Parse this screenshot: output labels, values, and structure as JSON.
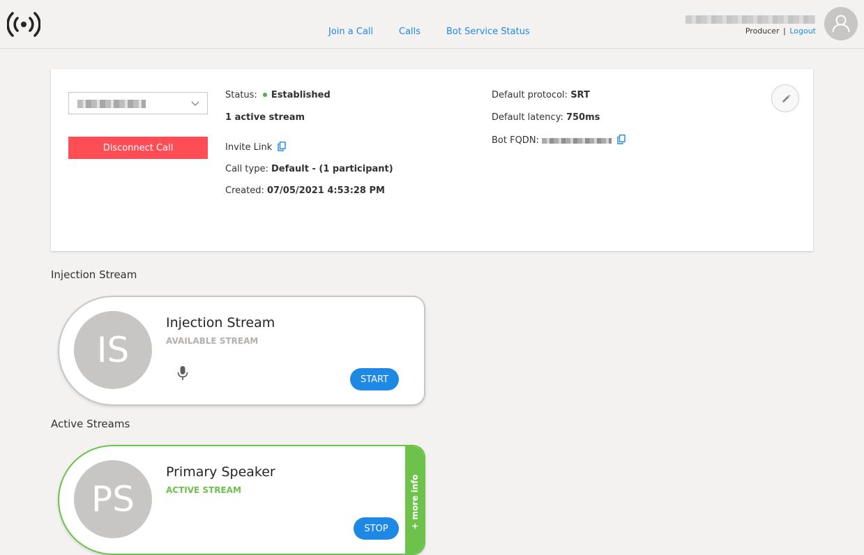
{
  "header": {
    "nav": [
      {
        "label": "Join a Call"
      },
      {
        "label": "Calls"
      },
      {
        "label": "Bot Service Status"
      }
    ],
    "user": {
      "role": "Producer",
      "separator": "|",
      "logout_label": "Logout"
    }
  },
  "call": {
    "disconnect_label": "Disconnect Call",
    "status_label": "Status:",
    "status_value": "Established",
    "active_streams": "1 active stream",
    "invite_label": "Invite Link",
    "call_type_label": "Call type:",
    "call_type_value": "Default - (1 participant)",
    "created_label": "Created:",
    "created_value": "07/05/2021 4:53:28 PM",
    "protocol_label": "Default protocol:",
    "protocol_value": "SRT",
    "latency_label": "Default latency:",
    "latency_value": "750ms",
    "fqdn_label": "Bot FQDN:"
  },
  "injection": {
    "section_title": "Injection Stream",
    "card": {
      "initials": "IS",
      "name": "Injection Stream",
      "state": "AVAILABLE STREAM",
      "button_label": "START"
    }
  },
  "active": {
    "section_title": "Active Streams",
    "card": {
      "initials": "PS",
      "name": "Primary Speaker",
      "state": "ACTIVE STREAM",
      "button_label": "STOP",
      "more_info_label": "+ more info"
    }
  },
  "colors": {
    "link": "#1e88e5",
    "danger": "#ff4d56",
    "active": "#6cc24a",
    "status_ok": "#4caf50",
    "background": "#f3f2f1"
  },
  "icons": {
    "logo": "broadcast-icon",
    "avatar": "user-icon",
    "edit": "pencil-icon",
    "copy": "copy-icon",
    "mic": "microphone-icon",
    "dropdown": "chevron-down-icon"
  }
}
